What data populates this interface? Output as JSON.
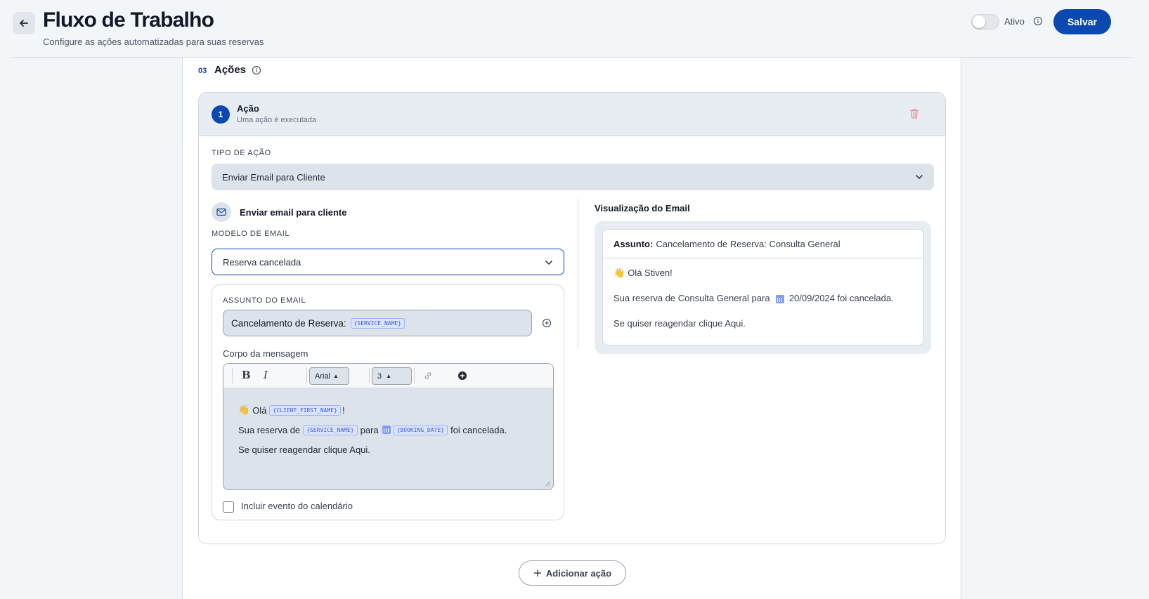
{
  "header": {
    "title": "Fluxo de Trabalho",
    "subtitle": "Configure as ações automatizadas para suas reservas",
    "toggle_label": "Ativo",
    "save_label": "Salvar"
  },
  "section": {
    "number": "03",
    "title": "Ações"
  },
  "action": {
    "number": "1",
    "title": "Ação",
    "subtitle": "Uma ação é executada",
    "type_label": "TIPO DE AÇÃO",
    "type_value": "Enviar Email para Cliente",
    "mail_title": "Enviar email para cliente",
    "template_label": "MODELO DE EMAIL",
    "template_value": "Reserva cancelada",
    "subject_label": "ASSUNTO DO EMAIL",
    "subject_text": "Cancelamento de Reserva:",
    "subject_tag": "{SERVICE_NAME}",
    "body_label": "Corpo da mensagem",
    "toolbar": {
      "bold": "B",
      "italic": "I",
      "font": "Arial",
      "size": "3"
    },
    "body": {
      "line1_text": "Olá",
      "line1_tag": "{CLIENT_FIRST_NAME}",
      "line1_end": "!",
      "line2_a": "Sua reserva de",
      "line2_tag1": "{SERVICE_NAME}",
      "line2_b": "para",
      "line2_tag2": "{BOOKING_DATE}",
      "line2_c": "foi cancelada.",
      "line3": "Se quiser reagendar clique Aqui."
    },
    "calendar_checkbox_label": "Incluir evento do calendário"
  },
  "preview": {
    "title": "Visualização do Email",
    "subject_key": "Assunto:",
    "subject_value": "Cancelamento de Reserva: Consulta General",
    "line1": "Olá Stiven!",
    "line2_a": "Sua reserva de Consulta General para",
    "line2_b": "20/09/2024 foi cancelada.",
    "line3": "Se quiser reagendar clique Aqui."
  },
  "add_action_label": "Adicionar ação",
  "colors": {
    "primary": "#0b49b0",
    "tag_bg": "#dbe4ff",
    "danger": "#f08c8c"
  }
}
